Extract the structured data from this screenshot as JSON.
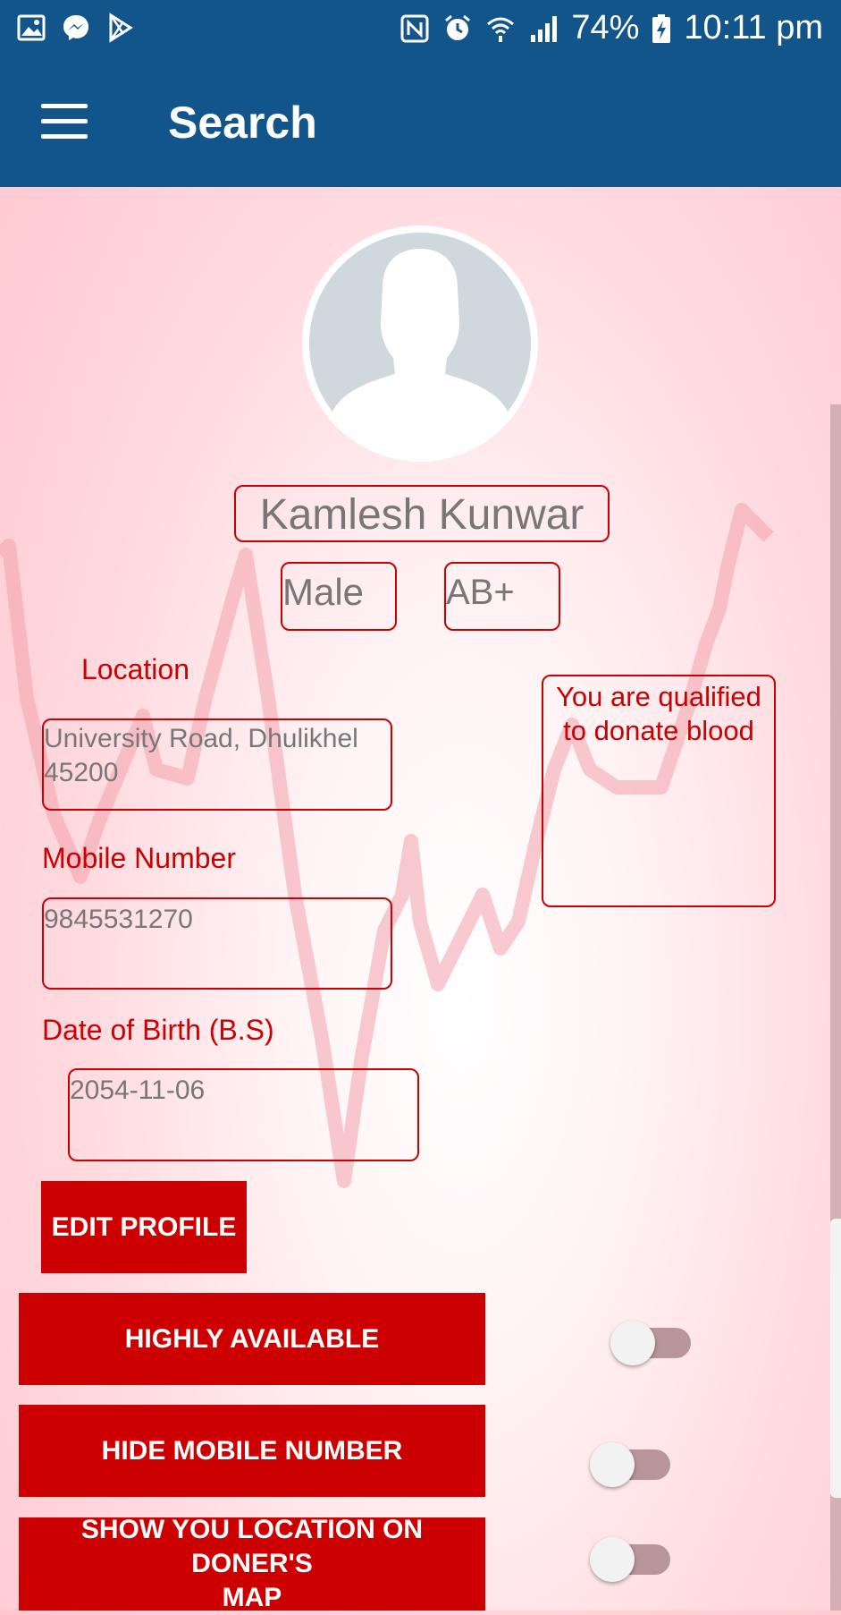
{
  "status_bar": {
    "battery": "74%",
    "time": "10:11 pm"
  },
  "app_bar": {
    "title": "Search"
  },
  "profile": {
    "name": "Kamlesh Kunwar",
    "gender": "Male",
    "blood_group": "AB+",
    "location_label": "Location",
    "location_line1": "University Road, Dhulikhel",
    "location_line2": "45200",
    "mobile_label": "Mobile Number",
    "mobile": "9845531270",
    "dob_label": "Date of Birth (B.S)",
    "dob": "2054-11-06",
    "qualification_line1": "You are qualified",
    "qualification_line2": "to donate blood"
  },
  "actions": {
    "edit_profile": "EDIT PROFILE",
    "highly_available": "HIGHLY AVAILABLE",
    "hide_mobile": "HIDE MOBILE NUMBER",
    "show_location_line1": "SHOW YOU LOCATION ON DONER'S",
    "show_location_line2": "MAP"
  },
  "toggles": {
    "highly_available_on": false,
    "hide_mobile_on": false,
    "show_location_on": false
  },
  "colors": {
    "primary": "#12558a",
    "accent": "#cc0000"
  }
}
